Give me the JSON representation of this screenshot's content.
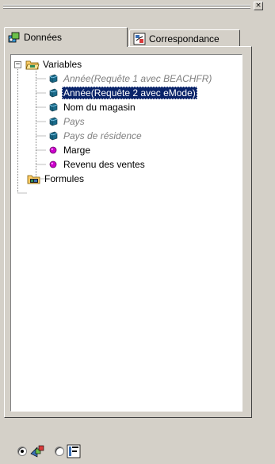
{
  "window": {
    "close_label": "×"
  },
  "tabs": [
    {
      "label": "Données",
      "icon": "data-provider-icon",
      "active": true
    },
    {
      "label": "Correspondance",
      "icon": "mapping-icon",
      "active": false
    }
  ],
  "tree": {
    "root_expander": "−",
    "folders": [
      {
        "label": "Variables",
        "icon": "folder-open-icon",
        "expanded": true
      },
      {
        "label": "Formules",
        "icon": "formula-folder-icon",
        "expanded": false
      }
    ],
    "variables": [
      {
        "label": "Année(Requête 1 avec BEACHFR)",
        "type": "dimension",
        "state": "disabled"
      },
      {
        "label": "Année(Requête 2 avec eMode)",
        "type": "dimension",
        "state": "selected"
      },
      {
        "label": "Nom du magasin",
        "type": "dimension",
        "state": "normal"
      },
      {
        "label": "Pays",
        "type": "dimension",
        "state": "disabled"
      },
      {
        "label": "Pays de résidence",
        "type": "dimension",
        "state": "disabled"
      },
      {
        "label": "Marge",
        "type": "measure",
        "state": "normal"
      },
      {
        "label": "Revenu des ventes",
        "type": "measure",
        "state": "normal"
      }
    ]
  },
  "bottom": {
    "options": [
      {
        "icon": "data-view-icon",
        "checked": true
      },
      {
        "icon": "formula-view-icon",
        "checked": false
      }
    ]
  },
  "colors": {
    "selection": "#0a246a",
    "dimension": "#1a6b8a",
    "measure": "#cc00cc",
    "folder": "#ffcc66"
  }
}
